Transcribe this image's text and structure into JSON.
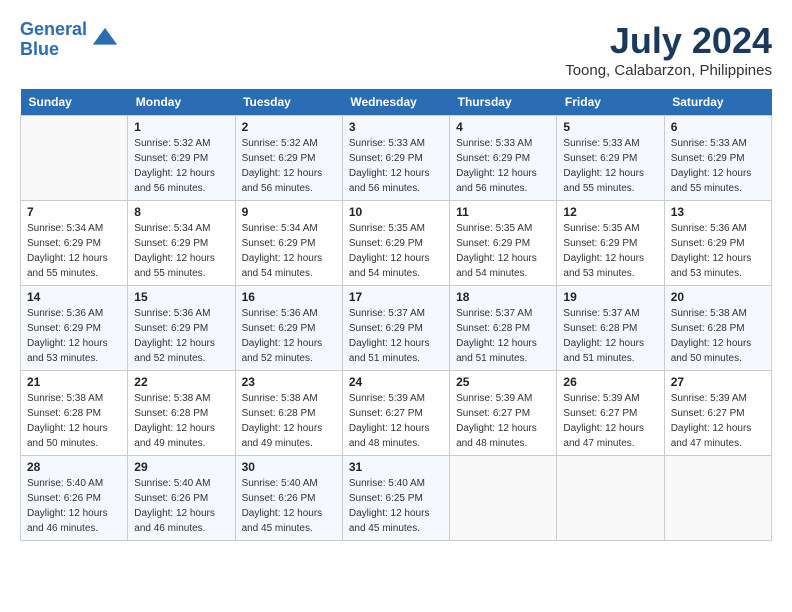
{
  "header": {
    "logo_line1": "General",
    "logo_line2": "Blue",
    "month_title": "July 2024",
    "location": "Toong, Calabarzon, Philippines"
  },
  "weekdays": [
    "Sunday",
    "Monday",
    "Tuesday",
    "Wednesday",
    "Thursday",
    "Friday",
    "Saturday"
  ],
  "weeks": [
    [
      {
        "num": "",
        "detail": ""
      },
      {
        "num": "1",
        "detail": "Sunrise: 5:32 AM\nSunset: 6:29 PM\nDaylight: 12 hours\nand 56 minutes."
      },
      {
        "num": "2",
        "detail": "Sunrise: 5:32 AM\nSunset: 6:29 PM\nDaylight: 12 hours\nand 56 minutes."
      },
      {
        "num": "3",
        "detail": "Sunrise: 5:33 AM\nSunset: 6:29 PM\nDaylight: 12 hours\nand 56 minutes."
      },
      {
        "num": "4",
        "detail": "Sunrise: 5:33 AM\nSunset: 6:29 PM\nDaylight: 12 hours\nand 56 minutes."
      },
      {
        "num": "5",
        "detail": "Sunrise: 5:33 AM\nSunset: 6:29 PM\nDaylight: 12 hours\nand 55 minutes."
      },
      {
        "num": "6",
        "detail": "Sunrise: 5:33 AM\nSunset: 6:29 PM\nDaylight: 12 hours\nand 55 minutes."
      }
    ],
    [
      {
        "num": "7",
        "detail": "Sunrise: 5:34 AM\nSunset: 6:29 PM\nDaylight: 12 hours\nand 55 minutes."
      },
      {
        "num": "8",
        "detail": "Sunrise: 5:34 AM\nSunset: 6:29 PM\nDaylight: 12 hours\nand 55 minutes."
      },
      {
        "num": "9",
        "detail": "Sunrise: 5:34 AM\nSunset: 6:29 PM\nDaylight: 12 hours\nand 54 minutes."
      },
      {
        "num": "10",
        "detail": "Sunrise: 5:35 AM\nSunset: 6:29 PM\nDaylight: 12 hours\nand 54 minutes."
      },
      {
        "num": "11",
        "detail": "Sunrise: 5:35 AM\nSunset: 6:29 PM\nDaylight: 12 hours\nand 54 minutes."
      },
      {
        "num": "12",
        "detail": "Sunrise: 5:35 AM\nSunset: 6:29 PM\nDaylight: 12 hours\nand 53 minutes."
      },
      {
        "num": "13",
        "detail": "Sunrise: 5:36 AM\nSunset: 6:29 PM\nDaylight: 12 hours\nand 53 minutes."
      }
    ],
    [
      {
        "num": "14",
        "detail": "Sunrise: 5:36 AM\nSunset: 6:29 PM\nDaylight: 12 hours\nand 53 minutes."
      },
      {
        "num": "15",
        "detail": "Sunrise: 5:36 AM\nSunset: 6:29 PM\nDaylight: 12 hours\nand 52 minutes."
      },
      {
        "num": "16",
        "detail": "Sunrise: 5:36 AM\nSunset: 6:29 PM\nDaylight: 12 hours\nand 52 minutes."
      },
      {
        "num": "17",
        "detail": "Sunrise: 5:37 AM\nSunset: 6:29 PM\nDaylight: 12 hours\nand 51 minutes."
      },
      {
        "num": "18",
        "detail": "Sunrise: 5:37 AM\nSunset: 6:28 PM\nDaylight: 12 hours\nand 51 minutes."
      },
      {
        "num": "19",
        "detail": "Sunrise: 5:37 AM\nSunset: 6:28 PM\nDaylight: 12 hours\nand 51 minutes."
      },
      {
        "num": "20",
        "detail": "Sunrise: 5:38 AM\nSunset: 6:28 PM\nDaylight: 12 hours\nand 50 minutes."
      }
    ],
    [
      {
        "num": "21",
        "detail": "Sunrise: 5:38 AM\nSunset: 6:28 PM\nDaylight: 12 hours\nand 50 minutes."
      },
      {
        "num": "22",
        "detail": "Sunrise: 5:38 AM\nSunset: 6:28 PM\nDaylight: 12 hours\nand 49 minutes."
      },
      {
        "num": "23",
        "detail": "Sunrise: 5:38 AM\nSunset: 6:28 PM\nDaylight: 12 hours\nand 49 minutes."
      },
      {
        "num": "24",
        "detail": "Sunrise: 5:39 AM\nSunset: 6:27 PM\nDaylight: 12 hours\nand 48 minutes."
      },
      {
        "num": "25",
        "detail": "Sunrise: 5:39 AM\nSunset: 6:27 PM\nDaylight: 12 hours\nand 48 minutes."
      },
      {
        "num": "26",
        "detail": "Sunrise: 5:39 AM\nSunset: 6:27 PM\nDaylight: 12 hours\nand 47 minutes."
      },
      {
        "num": "27",
        "detail": "Sunrise: 5:39 AM\nSunset: 6:27 PM\nDaylight: 12 hours\nand 47 minutes."
      }
    ],
    [
      {
        "num": "28",
        "detail": "Sunrise: 5:40 AM\nSunset: 6:26 PM\nDaylight: 12 hours\nand 46 minutes."
      },
      {
        "num": "29",
        "detail": "Sunrise: 5:40 AM\nSunset: 6:26 PM\nDaylight: 12 hours\nand 46 minutes."
      },
      {
        "num": "30",
        "detail": "Sunrise: 5:40 AM\nSunset: 6:26 PM\nDaylight: 12 hours\nand 45 minutes."
      },
      {
        "num": "31",
        "detail": "Sunrise: 5:40 AM\nSunset: 6:25 PM\nDaylight: 12 hours\nand 45 minutes."
      },
      {
        "num": "",
        "detail": ""
      },
      {
        "num": "",
        "detail": ""
      },
      {
        "num": "",
        "detail": ""
      }
    ]
  ]
}
